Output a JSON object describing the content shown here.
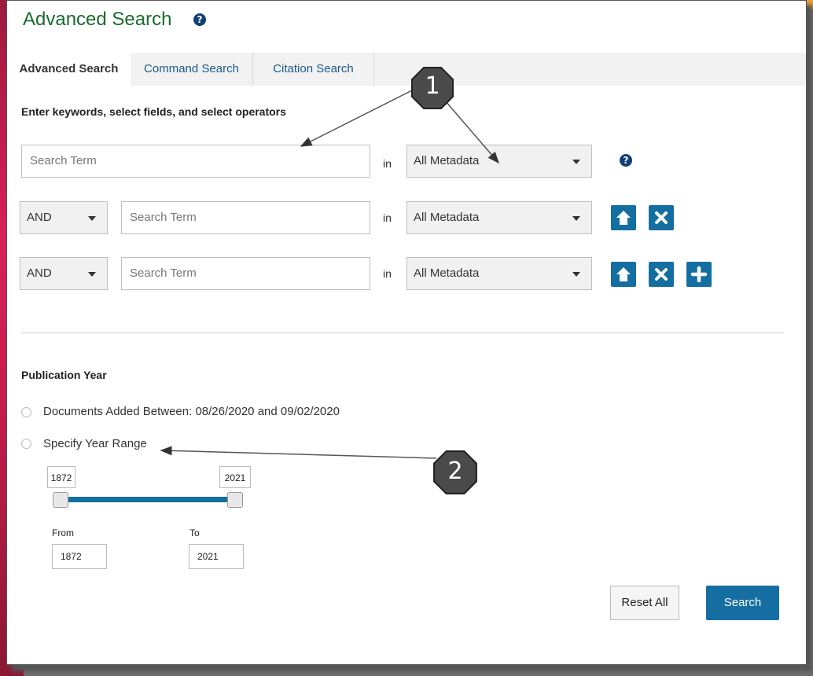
{
  "header": {
    "title": "Advanced Search",
    "help_icon": "question-circle-icon"
  },
  "tabs": [
    {
      "label": "Advanced Search",
      "active": true
    },
    {
      "label": "Command Search",
      "active": false
    },
    {
      "label": "Citation Search",
      "active": false
    }
  ],
  "instructions": "Enter keywords, select fields, and select operators",
  "rows": [
    {
      "term_placeholder": "Search Term",
      "in_label": "in",
      "field": "All Metadata"
    },
    {
      "operator": "AND",
      "term_placeholder": "Search Term",
      "in_label": "in",
      "field": "All Metadata"
    },
    {
      "operator": "AND",
      "term_placeholder": "Search Term",
      "in_label": "in",
      "field": "All Metadata"
    }
  ],
  "row_icons": {
    "move_up": "arrow-up-icon",
    "remove": "times-icon",
    "add": "plus-icon"
  },
  "publication": {
    "title": "Publication Year",
    "option_added": "Documents Added Between: 08/26/2020 and 09/02/2020",
    "option_range": "Specify Year Range",
    "slider_min": "1872",
    "slider_max": "2021",
    "from_label": "From",
    "to_label": "To",
    "from_value": "1872",
    "to_value": "2021"
  },
  "buttons": {
    "reset": "Reset All",
    "search": "Search"
  },
  "callouts": [
    "1",
    "2"
  ],
  "colors": {
    "accent": "#146ea1",
    "title_green": "#1a6b2f",
    "callout": "#4a4a4a"
  }
}
